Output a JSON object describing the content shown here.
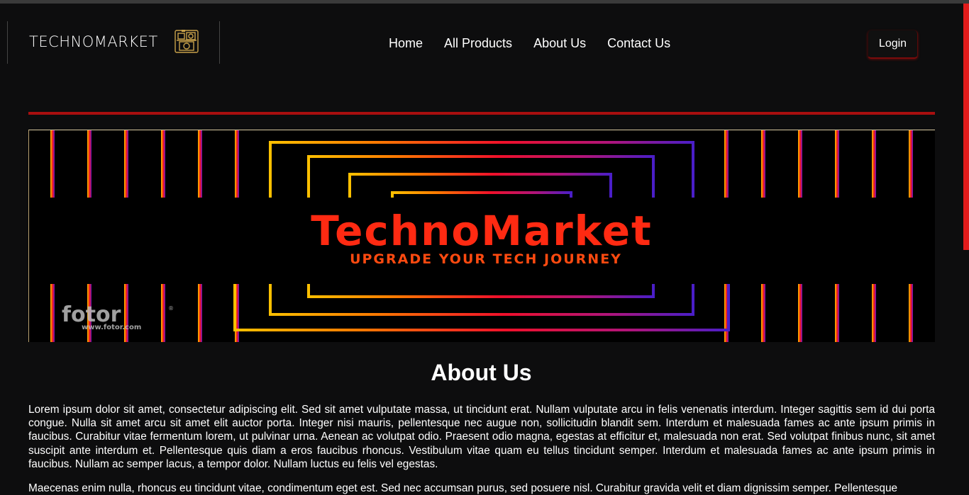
{
  "brand": {
    "name": "TECHNOMARKET",
    "logo_icon": "camera-icon"
  },
  "nav": {
    "items": [
      {
        "label": "Home"
      },
      {
        "label": "All Products"
      },
      {
        "label": "About Us"
      },
      {
        "label": "Contact Us"
      }
    ]
  },
  "header": {
    "login_label": "Login"
  },
  "banner": {
    "title": "TechnoMarket",
    "tagline": "UPGRADE YOUR TECH JOURNEY",
    "watermark": "fotor",
    "watermark_url": "www.fotor.com",
    "watermark_mark": "®"
  },
  "about": {
    "title": "About Us",
    "paragraphs": [
      "Lorem ipsum dolor sit amet, consectetur adipiscing elit. Sed sit amet vulputate massa, ut tincidunt erat. Nullam vulputate arcu in felis venenatis interdum. Integer sagittis sem id dui porta congue. Nulla sit amet arcu sit amet elit auctor porta. Integer nisi mauris, pellentesque nec augue non, sollicitudin blandit sem. Interdum et malesuada fames ac ante ipsum primis in faucibus. Curabitur vitae fermentum lorem, ut pulvinar urna. Aenean ac volutpat odio. Praesent odio magna, egestas at efficitur et, malesuada non erat. Sed volutpat finibus nunc, sit amet suscipit ante interdum et. Pellentesque quis diam a eros faucibus rhoncus. Vestibulum vitae quam eu tellus tincidunt semper. Interdum et malesuada fames ac ante ipsum primis in faucibus. Nullam ac semper lacus, a tempor dolor. Nullam luctus eu felis vel egestas.",
      "Maecenas enim nulla, rhoncus eu tincidunt vitae, condimentum eget est. Sed nec accumsan purus, sed posuere nisl. Curabitur gravida velit et diam dignissim semper. Pellentesque"
    ]
  },
  "colors": {
    "background": "#0d0d0e",
    "accent_red": "#a80f0f",
    "scrollbar": "#e11b1b",
    "banner_title": "#ff2a12",
    "banner_tagline": "#ff4a10"
  }
}
